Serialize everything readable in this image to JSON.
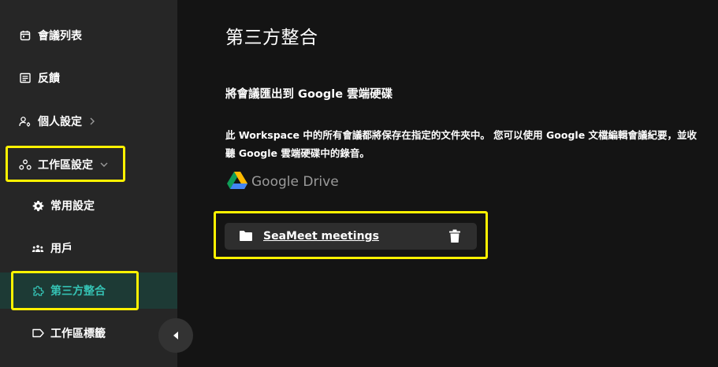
{
  "sidebar": {
    "items": [
      {
        "label": "會議列表",
        "icon": "calendar-icon"
      },
      {
        "label": "反饋",
        "icon": "feedback-icon"
      },
      {
        "label": "個人設定",
        "icon": "user-settings-icon"
      },
      {
        "label": "工作區設定",
        "icon": "workspace-icon"
      },
      {
        "label": "常用設定",
        "icon": "gear-icon"
      },
      {
        "label": "用戶",
        "icon": "users-icon"
      },
      {
        "label": "第三方整合",
        "icon": "puzzle-icon"
      },
      {
        "label": "工作區標籤",
        "icon": "tag-icon"
      }
    ],
    "active_index": 6
  },
  "main": {
    "title": "第三方整合",
    "section_title": "將會議匯出到 Google 雲端硬碟",
    "description": "此 Workspace 中的所有會議都將保存在指定的文件夾中。 您可以使用 Google 文檔編輯會議紀要，並收聽 Google 雲端硬碟中的錄音。",
    "drive_logo_text": "Google Drive",
    "folder": {
      "name": "SeaMeet meetings"
    }
  },
  "colors": {
    "highlight": "#fff200",
    "accent": "#35c2b4",
    "sidebar_bg": "#262626",
    "main_bg": "#141414"
  }
}
